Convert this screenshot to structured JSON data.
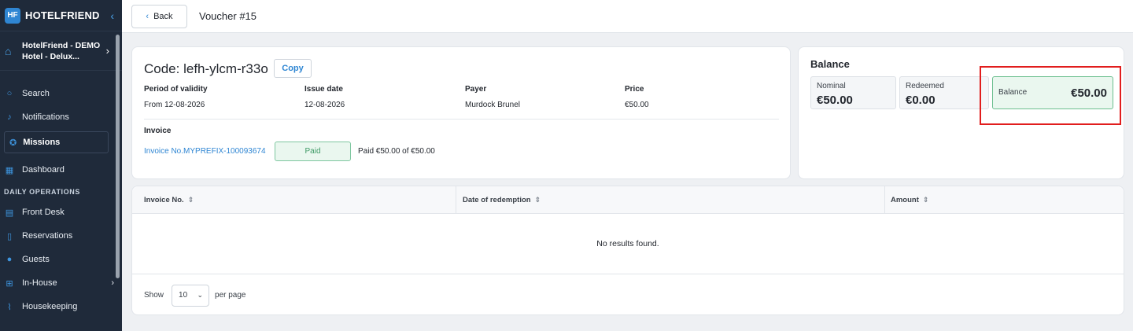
{
  "app": {
    "brand": "HOTELFRIEND",
    "brand_mark": "HF"
  },
  "sidebar": {
    "hotel_line1": "HotelFriend - DEMO",
    "hotel_line2": "Hotel - Delux...",
    "top_items": [
      {
        "label": "Search"
      },
      {
        "label": "Notifications"
      }
    ],
    "missions_label": "Missions",
    "dashboard_label": "Dashboard",
    "section_title": "DAILY OPERATIONS",
    "ops_items": [
      {
        "label": "Front Desk"
      },
      {
        "label": "Reservations"
      },
      {
        "label": "Guests"
      },
      {
        "label": "In-House"
      },
      {
        "label": "Housekeeping"
      }
    ]
  },
  "header": {
    "back_label": "Back",
    "title": "Voucher #15"
  },
  "voucher": {
    "code_title": "Code: lefh-ylcm-r33o",
    "copy_label": "Copy",
    "fields": {
      "validity": {
        "label": "Period of validity",
        "value": "From 12-08-2026"
      },
      "issue_date": {
        "label": "Issue date",
        "value": "12-08-2026"
      },
      "payer": {
        "label": "Payer",
        "value": "Murdock Brunel"
      },
      "price": {
        "label": "Price",
        "value": "€50.00"
      }
    },
    "invoice": {
      "label": "Invoice",
      "number": "Invoice No.MYPREFIX-100093674",
      "status": "Paid",
      "paid_text": "Paid €50.00 of €50.00"
    }
  },
  "balance": {
    "title": "Balance",
    "nominal": {
      "label": "Nominal",
      "value": "€50.00"
    },
    "redeemed": {
      "label": "Redeemed",
      "value": "€0.00"
    },
    "balance": {
      "label": "Balance",
      "value": "€50.00"
    }
  },
  "table": {
    "columns": [
      "Invoice No.",
      "Date of redemption",
      "Amount"
    ],
    "empty_text": "No results found.",
    "footer": {
      "show_label": "Show",
      "page_size": "10",
      "per_page_label": "per page"
    }
  },
  "colors": {
    "accent": "#2f86d3",
    "sidebar_bg": "#1f2a3a",
    "success": "#3e9a66",
    "highlight": "#e11d1d"
  }
}
